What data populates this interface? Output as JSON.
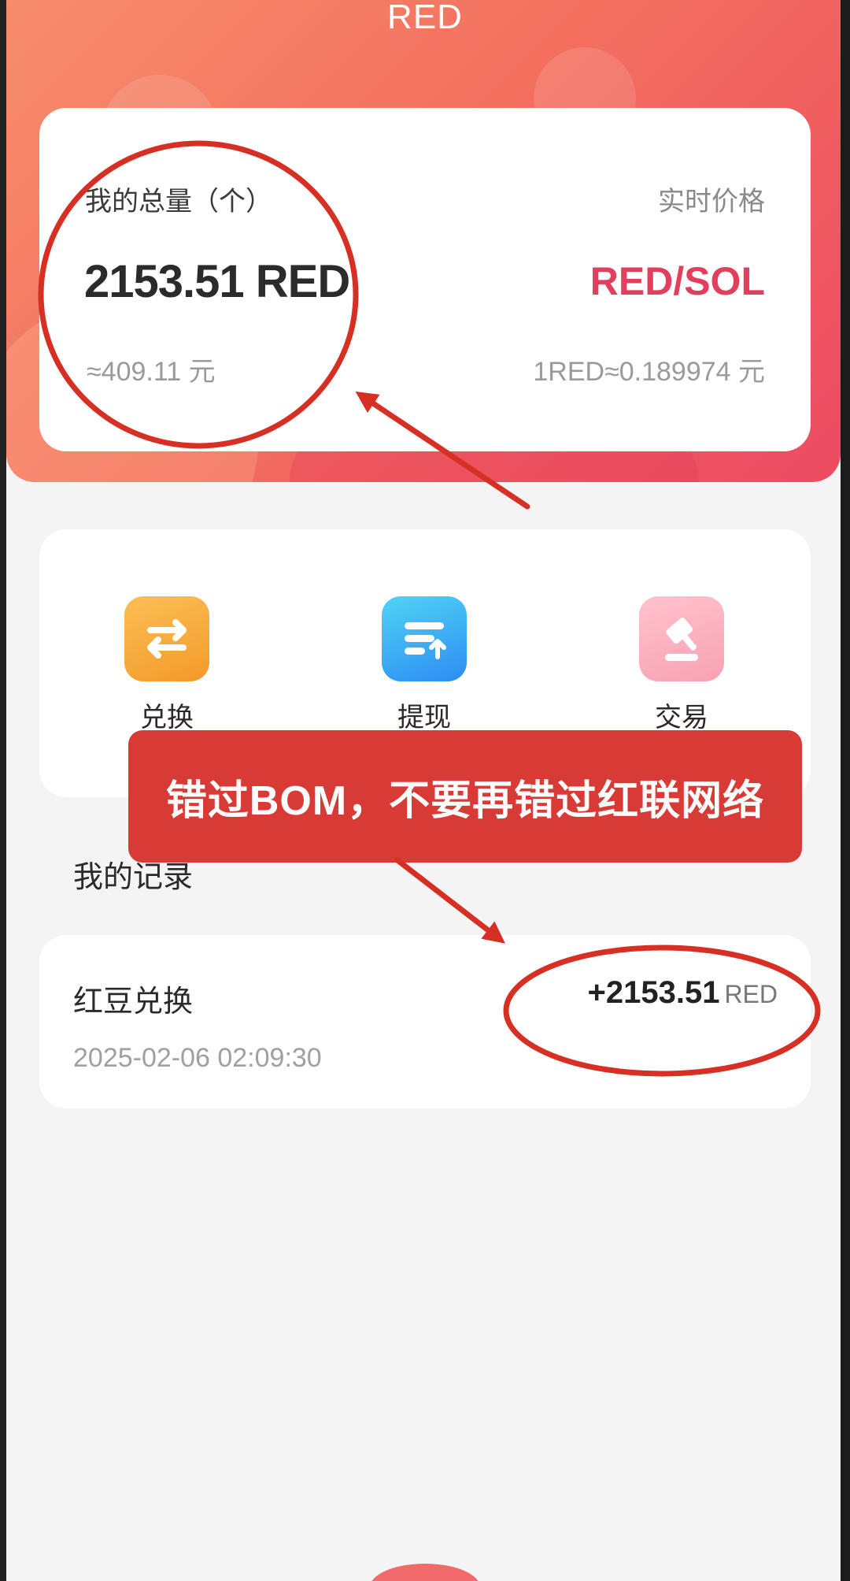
{
  "header": {
    "title": "RED"
  },
  "total": {
    "label": "我的总量（个）",
    "amount": "2153.51 RED",
    "approx_value": "≈409.11 元",
    "price_label": "实时价格",
    "pair": "RED/SOL",
    "unit_price": "1RED≈0.189974 元"
  },
  "actions": [
    {
      "label": "兑换",
      "icon": "exchange-icon"
    },
    {
      "label": "提现",
      "icon": "withdraw-icon"
    },
    {
      "label": "交易",
      "icon": "gavel-icon"
    }
  ],
  "records": {
    "title": "我的记录",
    "items": [
      {
        "title": "红豆兑换",
        "amount": "+2153.51",
        "unit": "RED",
        "time": "2025-02-06 02:09:30"
      }
    ]
  },
  "overlay": {
    "banner_text": "错过BOM，不要再错过红联网络"
  },
  "colors": {
    "accent": "#e0405e",
    "banner": "#d83b36",
    "header_start": "#f78d6c",
    "header_end": "#ec4a62"
  }
}
